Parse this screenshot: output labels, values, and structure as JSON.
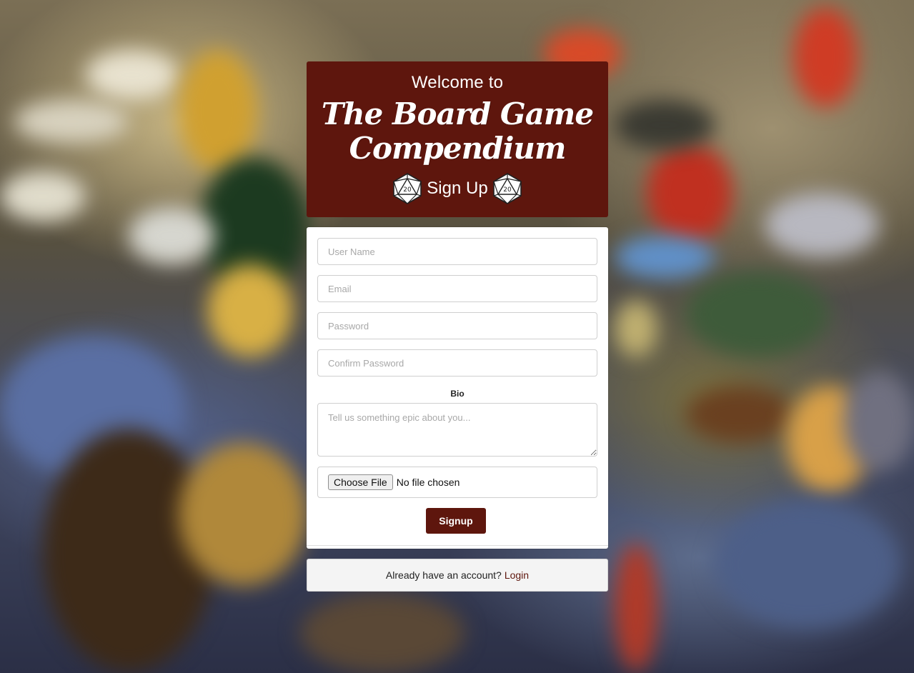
{
  "header": {
    "welcome": "Welcome to",
    "title": "The Board Game Compendium",
    "subtitle": "Sign Up"
  },
  "form": {
    "username_placeholder": "User Name",
    "email_placeholder": "Email",
    "password_placeholder": "Password",
    "confirm_placeholder": "Confirm Password",
    "bio_label": "Bio",
    "bio_placeholder": "Tell us something epic about you...",
    "file_button": "Choose File",
    "file_status": "No file chosen",
    "submit_label": "Signup"
  },
  "footer": {
    "prompt": "Already have an account?",
    "login_link": "Login"
  },
  "colors": {
    "brand": "#5e160d",
    "card": "#ffffff",
    "footer_bg": "#f4f4f4"
  },
  "icons": [
    "d20-dice-icon",
    "d20-dice-icon"
  ]
}
